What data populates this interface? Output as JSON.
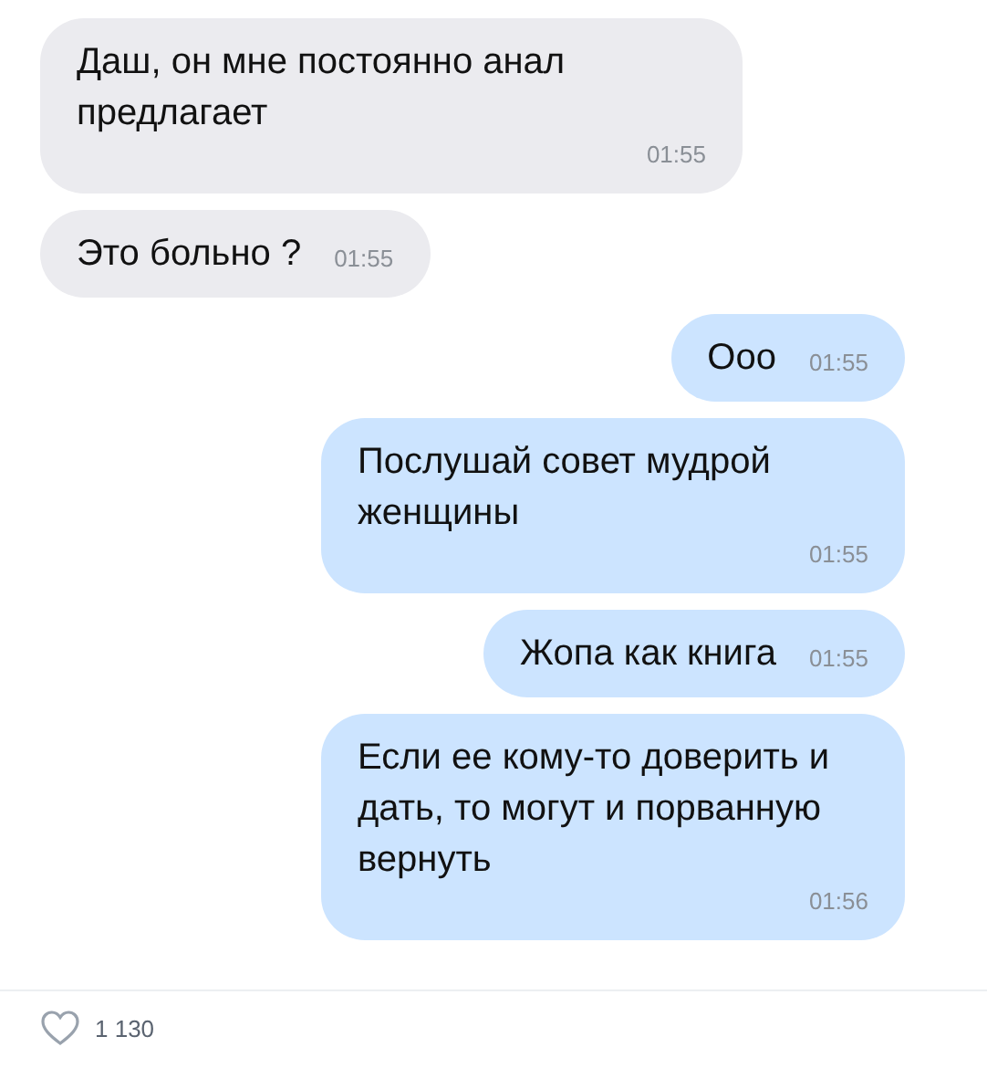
{
  "messages": [
    {
      "kind": "incoming",
      "text": "Даш, он мне постоянно анал предлагает",
      "time": "01:55"
    },
    {
      "kind": "incoming",
      "text": "Это больно ?",
      "time": "01:55"
    },
    {
      "kind": "outgoing",
      "text": "Ооо",
      "time": "01:55"
    },
    {
      "kind": "outgoing",
      "text": "Послушай совет мудрой женщины",
      "time": "01:55"
    },
    {
      "kind": "outgoing",
      "text": "Жопа как книга",
      "time": "01:55"
    },
    {
      "kind": "outgoing",
      "text": "Если ее кому-то доверить и дать, то могут и порванную вернуть",
      "time": "01:56"
    }
  ],
  "likes": {
    "count": "1 130",
    "liked": false
  }
}
